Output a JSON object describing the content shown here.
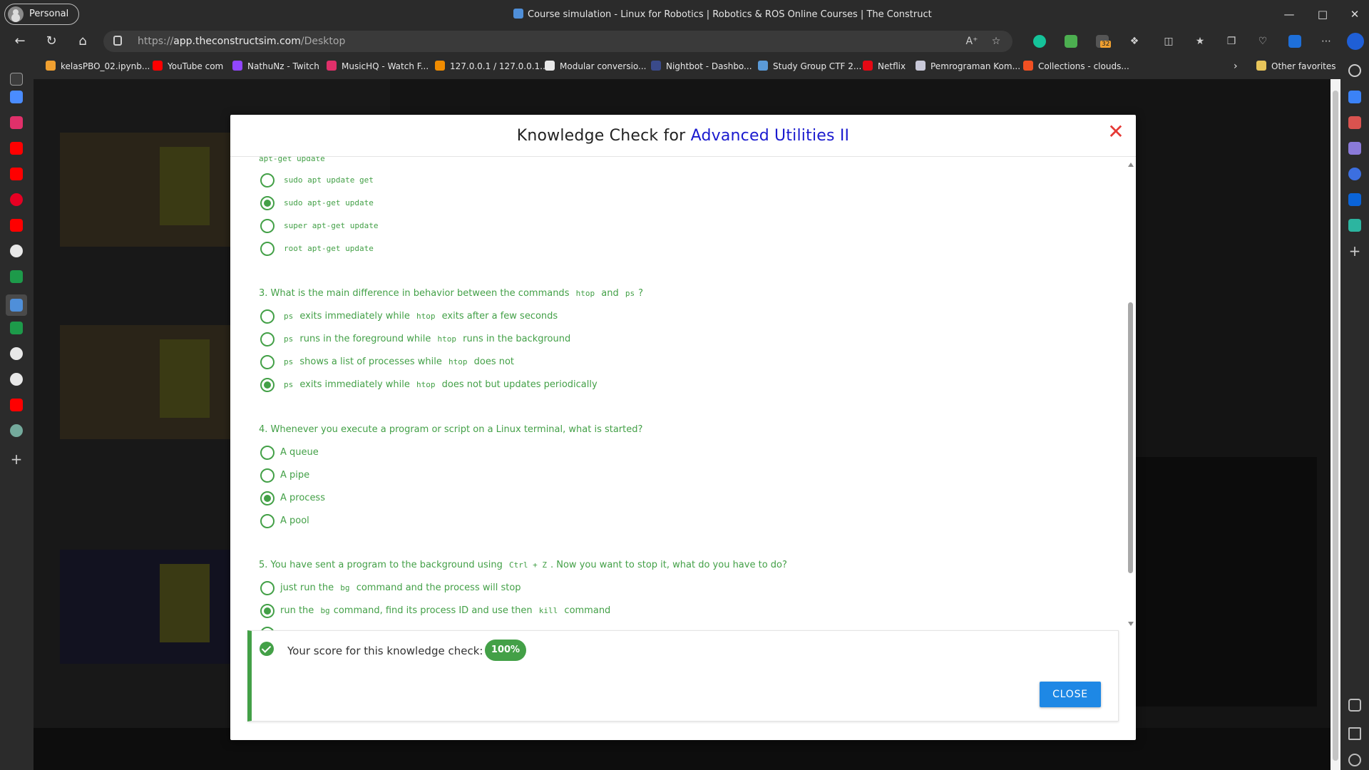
{
  "browser": {
    "profile_label": "Personal",
    "tab_title": "Course simulation - Linux for Robotics | Robotics & ROS Online Courses | The Construct",
    "url_prefix": "https://",
    "url_host": "app.theconstructsim.com",
    "url_path": "/Desktop",
    "extension_badge": "32"
  },
  "favorites": [
    {
      "label": "kelasPBO_02.ipynb...",
      "color": "#f0a030"
    },
    {
      "label": "YouTube com",
      "color": "#ff0000"
    },
    {
      "label": "NathuNz - Twitch",
      "color": "#9146ff"
    },
    {
      "label": "MusicHQ - Watch F...",
      "color": "#e0306a"
    },
    {
      "label": "127.0.0.1 / 127.0.0.1...",
      "color": "#f08c00"
    },
    {
      "label": "Modular conversio...",
      "color": "#e8e8e8"
    },
    {
      "label": "Nightbot - Dashbo...",
      "color": "#3a4a8a"
    },
    {
      "label": "Study Group CTF 2...",
      "color": "#5a9ad8"
    },
    {
      "label": "Netflix",
      "color": "#e50914"
    },
    {
      "label": "Pemrograman Kom...",
      "color": "#c8c8d8"
    },
    {
      "label": "Collections - clouds...",
      "color": "#f25022"
    },
    {
      "label": "Other favorites",
      "color": "#e8c55a"
    }
  ],
  "modal": {
    "title_prefix": "Knowledge Check for ",
    "title_highlight": "Advanced Utilities II",
    "cut_off_text": "apt-get update",
    "q2_options": [
      {
        "code": "sudo apt update get",
        "selected": false
      },
      {
        "code": "sudo apt-get update",
        "selected": true
      },
      {
        "code": "super apt-get update",
        "selected": false
      },
      {
        "code": "root apt-get update",
        "selected": false
      }
    ],
    "q3": {
      "prefix": "3. What is the main difference in behavior between the commands",
      "code1": "htop",
      "mid": "and",
      "code2": "ps",
      "suffix": "?",
      "options": [
        {
          "c1": "ps",
          "t1": "exits immediately while",
          "c2": "htop",
          "t2": "exits after a few seconds",
          "selected": false
        },
        {
          "c1": "ps",
          "t1": "runs in the foreground while",
          "c2": "htop",
          "t2": "runs in the background",
          "selected": false
        },
        {
          "c1": "ps",
          "t1": "shows a list of processes while",
          "c2": "htop",
          "t2": "does not",
          "selected": false
        },
        {
          "c1": "ps",
          "t1": "exits immediately while",
          "c2": "htop",
          "t2": "does not but updates periodically",
          "selected": true
        }
      ]
    },
    "q4": {
      "text": "4. Whenever you execute a program or script on a Linux terminal, what is started?",
      "options": [
        {
          "label": "A queue",
          "selected": false
        },
        {
          "label": "A pipe",
          "selected": false
        },
        {
          "label": "A process",
          "selected": true
        },
        {
          "label": "A pool",
          "selected": false
        }
      ]
    },
    "q5": {
      "prefix": "5. You have sent a program to the background using",
      "code": "Ctrl + Z",
      "suffix": ". Now you want to stop it, what do you have to do?",
      "options": [
        {
          "t1": "just run the",
          "c1": "bg",
          "t2": "command and the process will stop",
          "c2": "",
          "t3": "",
          "selected": false
        },
        {
          "t1": "run the",
          "c1": "bg",
          "t2": "command, find its process ID and use then",
          "c2": "kill",
          "t3": "command",
          "selected": true
        }
      ]
    },
    "result": {
      "text": "Your score for this knowledge check:",
      "score": "100%",
      "close_label": "CLOSE"
    }
  },
  "colors": {
    "accent_green": "#43a047",
    "title_blue": "#1a1acf",
    "close_red": "#e53935",
    "button_blue": "#1e88e5"
  }
}
